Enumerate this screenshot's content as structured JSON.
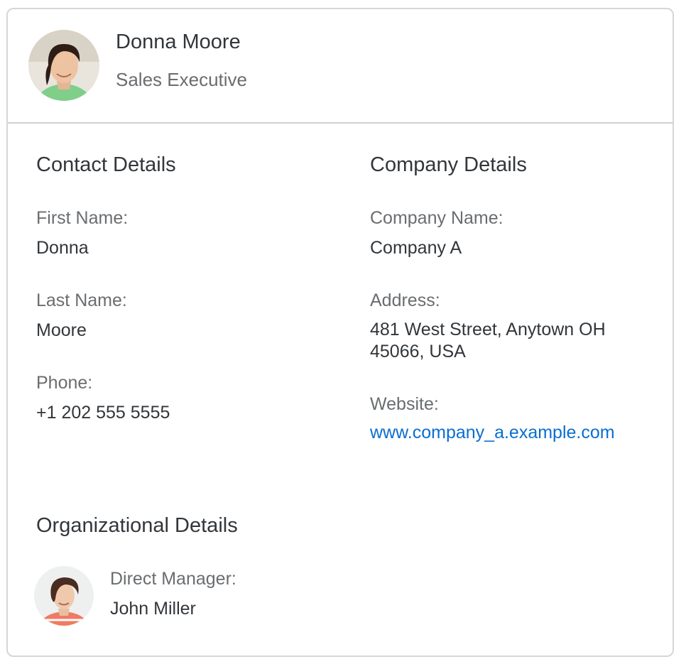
{
  "header": {
    "name": "Donna Moore",
    "role": "Sales Executive"
  },
  "contact": {
    "title": "Contact Details",
    "first_name_label": "First Name:",
    "first_name": "Donna",
    "last_name_label": "Last Name:",
    "last_name": "Moore",
    "phone_label": "Phone:",
    "phone": "+1 202 555 5555"
  },
  "company": {
    "title": "Company Details",
    "name_label": "Company Name:",
    "name": "Company A",
    "address_label": "Address:",
    "address": "481 West Street, Anytown OH 45066, USA",
    "website_label": "Website:",
    "website": "www.company_a.example.com"
  },
  "organization": {
    "title": "Organizational Details",
    "manager_label": "Direct Manager:",
    "manager": "John Miller"
  },
  "colors": {
    "link": "#0a6ed1",
    "label": "#6a6d70",
    "text": "#32363a",
    "border": "#d6d6d6"
  },
  "icons": {
    "header_avatar": "person-photo-avatar",
    "manager_avatar": "person-photo-avatar"
  }
}
